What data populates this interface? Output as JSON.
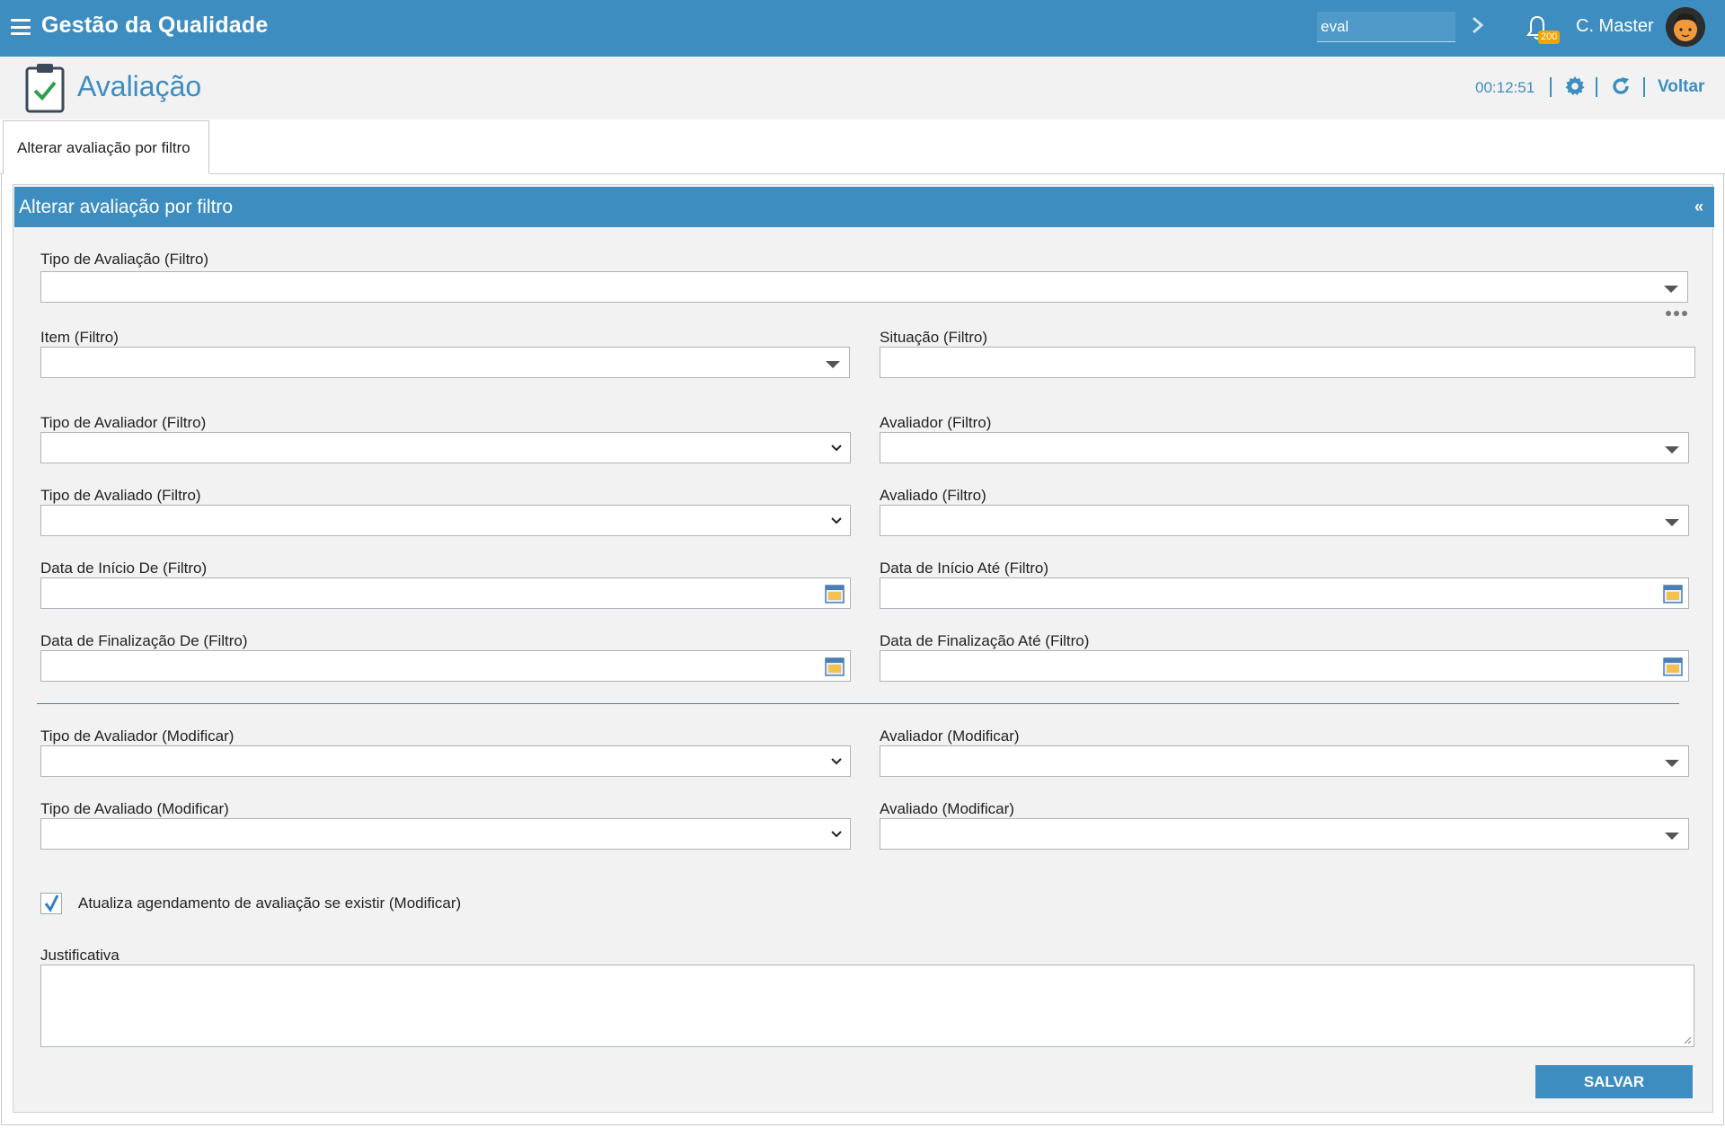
{
  "topbar": {
    "app_title": "Gestão da Qualidade",
    "search_value": "eval",
    "notification_count": "200",
    "user_name": "C. Master"
  },
  "header": {
    "title": "Avaliação",
    "timer": "00:12:51",
    "back_label": "Voltar"
  },
  "tabs": [
    {
      "label": "Alterar avaliação por filtro"
    }
  ],
  "panel": {
    "title": "Alterar avaliação por filtro",
    "collapse_glyph": "«"
  },
  "form": {
    "tipo_avaliacao_filtro": "Tipo de Avaliação (Filtro)",
    "item_filtro": "Item (Filtro)",
    "situacao_filtro": "Situação (Filtro)",
    "tipo_avaliador_filtro": "Tipo de Avaliador (Filtro)",
    "avaliador_filtro": "Avaliador (Filtro)",
    "tipo_avaliado_filtro": "Tipo de Avaliado (Filtro)",
    "avaliado_filtro": "Avaliado (Filtro)",
    "data_inicio_de": "Data de Início De (Filtro)",
    "data_inicio_ate": "Data de Início Até (Filtro)",
    "data_final_de": "Data de Finalização De (Filtro)",
    "data_final_ate": "Data de Finalização Até (Filtro)",
    "tipo_avaliador_mod": "Tipo de Avaliador (Modificar)",
    "avaliador_mod": "Avaliador (Modificar)",
    "tipo_avaliado_mod": "Tipo de Avaliado (Modificar)",
    "avaliado_mod": "Avaliado (Modificar)",
    "checkbox_label": "Atualiza agendamento de avaliação se existir (Modificar)",
    "checkbox_checked": true,
    "justificativa": "Justificativa",
    "save_label": "SALVAR"
  },
  "colors": {
    "brand": "#3d8dc0",
    "badge": "#f0a400",
    "check": "#2e9e4f"
  },
  "icons": [
    "menu-icon",
    "chevron-right-icon",
    "bell-icon",
    "avatar",
    "clipboard-check-icon",
    "gear-icon",
    "refresh-icon",
    "calendar-icon",
    "dropdown-icon",
    "more-icon",
    "checkmark-icon"
  ]
}
